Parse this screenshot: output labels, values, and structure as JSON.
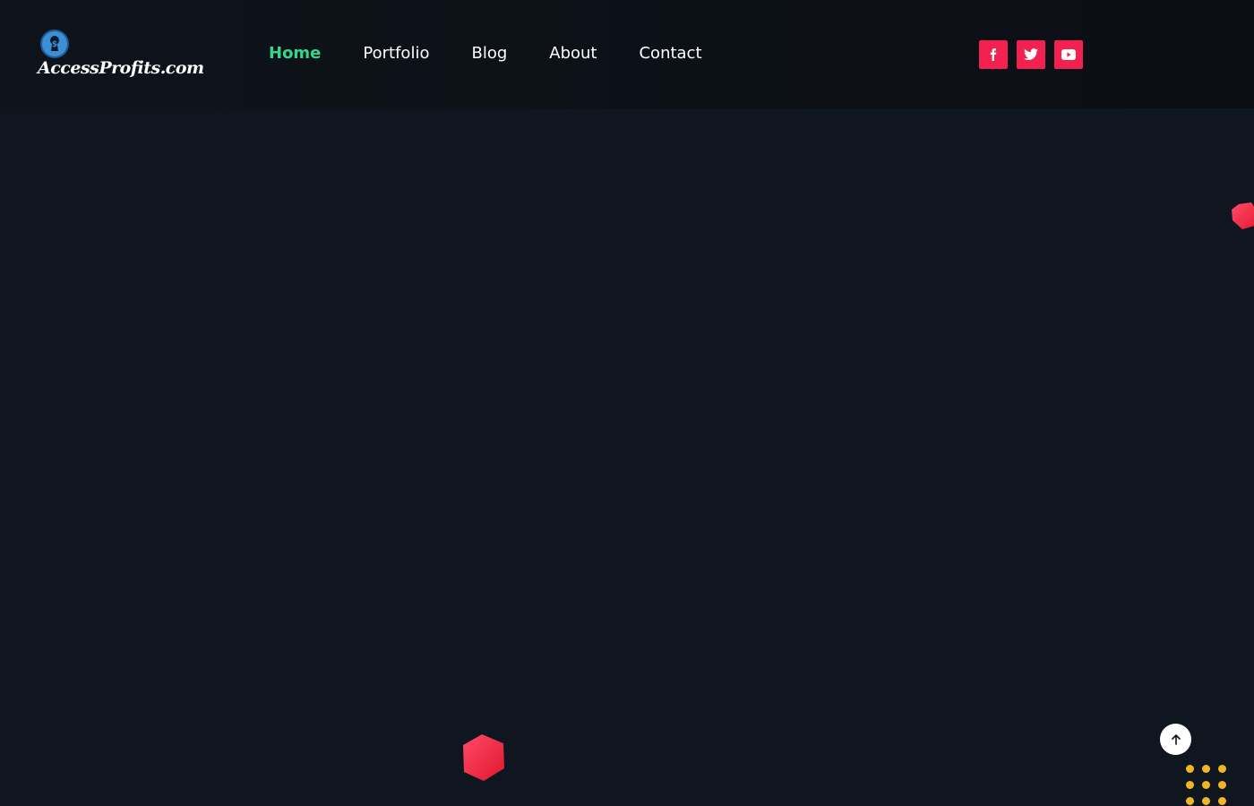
{
  "brand": {
    "name": "AccessProfits.com",
    "icon": "dollar-keyhole-icon"
  },
  "nav": {
    "items": [
      {
        "label": "Home",
        "active": true
      },
      {
        "label": "Portfolio",
        "active": false
      },
      {
        "label": "Blog",
        "active": false
      },
      {
        "label": "About",
        "active": false
      },
      {
        "label": "Contact",
        "active": false
      }
    ]
  },
  "social": [
    {
      "icon": "facebook-icon"
    },
    {
      "icon": "twitter-icon"
    },
    {
      "icon": "youtube-icon"
    }
  ],
  "controls": {
    "scroll_top_icon": "arrow-up-icon"
  },
  "colors": {
    "background": "#101620",
    "header_background": "#0c1017",
    "nav_active": "#31d88a",
    "nav_text": "#ffffff",
    "social_button": "#f2214f",
    "hexagon": "#f2214f",
    "dots": "#f2b623"
  }
}
